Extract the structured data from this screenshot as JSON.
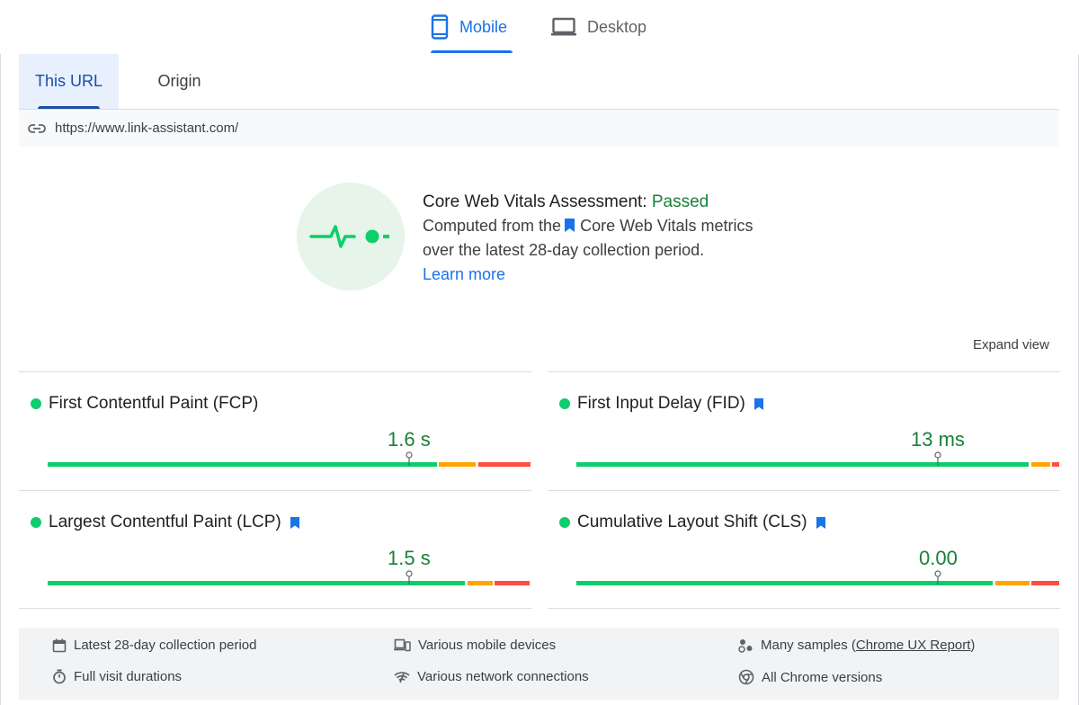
{
  "device_tabs": {
    "mobile": "Mobile",
    "desktop": "Desktop"
  },
  "scope_tabs": {
    "this_url": "This URL",
    "origin": "Origin"
  },
  "url": "https://www.link-assistant.com/",
  "assessment": {
    "title": "Core Web Vitals Assessment:",
    "status": "Passed",
    "line1_before": "Computed from the",
    "line1_after": "Core Web Vitals metrics",
    "line2": "over the latest 28-day collection period.",
    "learn_more": "Learn more"
  },
  "expand_view": "Expand view",
  "metrics": [
    {
      "name": "First Contentful Paint (FCP)",
      "value": "1.6 s",
      "core": false
    },
    {
      "name": "First Input Delay (FID)",
      "value": "13 ms",
      "core": true
    },
    {
      "name": "Largest Contentful Paint (LCP)",
      "value": "1.5 s",
      "core": true
    },
    {
      "name": "Cumulative Layout Shift (CLS)",
      "value": "0.00",
      "core": true
    }
  ],
  "footer": {
    "period": "Latest 28-day collection period",
    "devices": "Various mobile devices",
    "samples_prefix": "Many samples (",
    "samples_link": "Chrome UX Report",
    "samples_suffix": ")",
    "durations": "Full visit durations",
    "network": "Various network connections",
    "chrome": "All Chrome versions"
  },
  "colors": {
    "good": "#0cce6b",
    "needs_improvement": "#ffa400",
    "poor": "#ff4e42",
    "accent": "#1a73e8",
    "passed": "#188038"
  }
}
